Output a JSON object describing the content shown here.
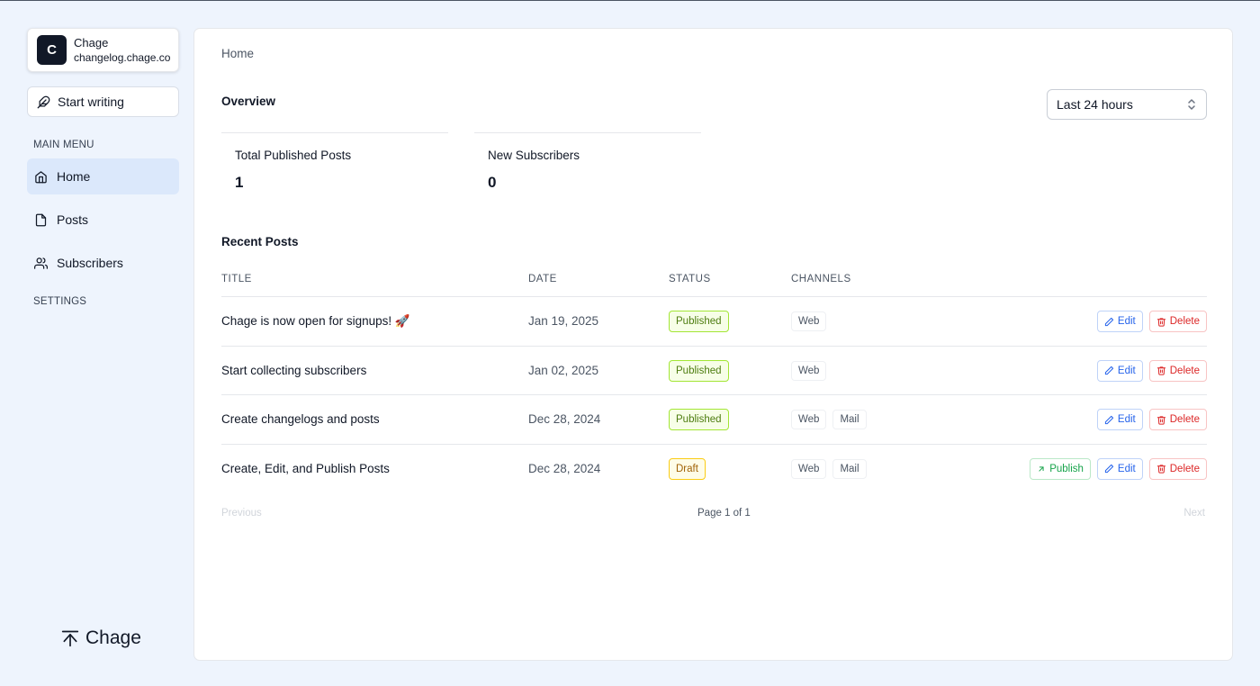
{
  "workspace": {
    "initial": "C",
    "name": "Chage",
    "domain": "changelog.chage.co"
  },
  "sidebar": {
    "start_label": "Start writing",
    "main_menu_heading": "MAIN MENU",
    "items": [
      {
        "label": "Home",
        "icon": "home-icon",
        "active": true
      },
      {
        "label": "Posts",
        "icon": "file-icon",
        "active": false
      },
      {
        "label": "Subscribers",
        "icon": "users-icon",
        "active": false
      }
    ],
    "settings_heading": "SETTINGS",
    "brand": "Chage"
  },
  "main": {
    "breadcrumb": "Home",
    "overview_title": "Overview",
    "range": {
      "selected": "Last 24 hours"
    },
    "stats": [
      {
        "label": "Total Published Posts",
        "value": "1"
      },
      {
        "label": "New Subscribers",
        "value": "0"
      }
    ],
    "recent_title": "Recent Posts",
    "table": {
      "headers": [
        "TITLE",
        "DATE",
        "STATUS",
        "CHANNELS"
      ],
      "rows": [
        {
          "title": "Chage is now open for signups! 🚀",
          "date": "Jan 19, 2025",
          "status": "Published",
          "channels": [
            "Web"
          ],
          "publish": false
        },
        {
          "title": "Start collecting subscribers",
          "date": "Jan 02, 2025",
          "status": "Published",
          "channels": [
            "Web"
          ],
          "publish": false
        },
        {
          "title": "Create changelogs and posts",
          "date": "Dec 28, 2024",
          "status": "Published",
          "channels": [
            "Web",
            "Mail"
          ],
          "publish": false
        },
        {
          "title": "Create, Edit, and Publish Posts",
          "date": "Dec 28, 2024",
          "status": "Draft",
          "channels": [
            "Web",
            "Mail"
          ],
          "publish": true
        }
      ],
      "actions": {
        "publish": "Publish",
        "edit": "Edit",
        "delete": "Delete"
      }
    },
    "pagination": {
      "previous": "Previous",
      "info": "Page 1 of 1",
      "next": "Next"
    }
  },
  "colors": {
    "background": "#eef4fd",
    "active_nav": "#dbe8fb",
    "published": "#4d7c0f",
    "draft": "#a16207",
    "edit": "#2563eb",
    "delete": "#dc2626",
    "publish": "#16a34a"
  }
}
